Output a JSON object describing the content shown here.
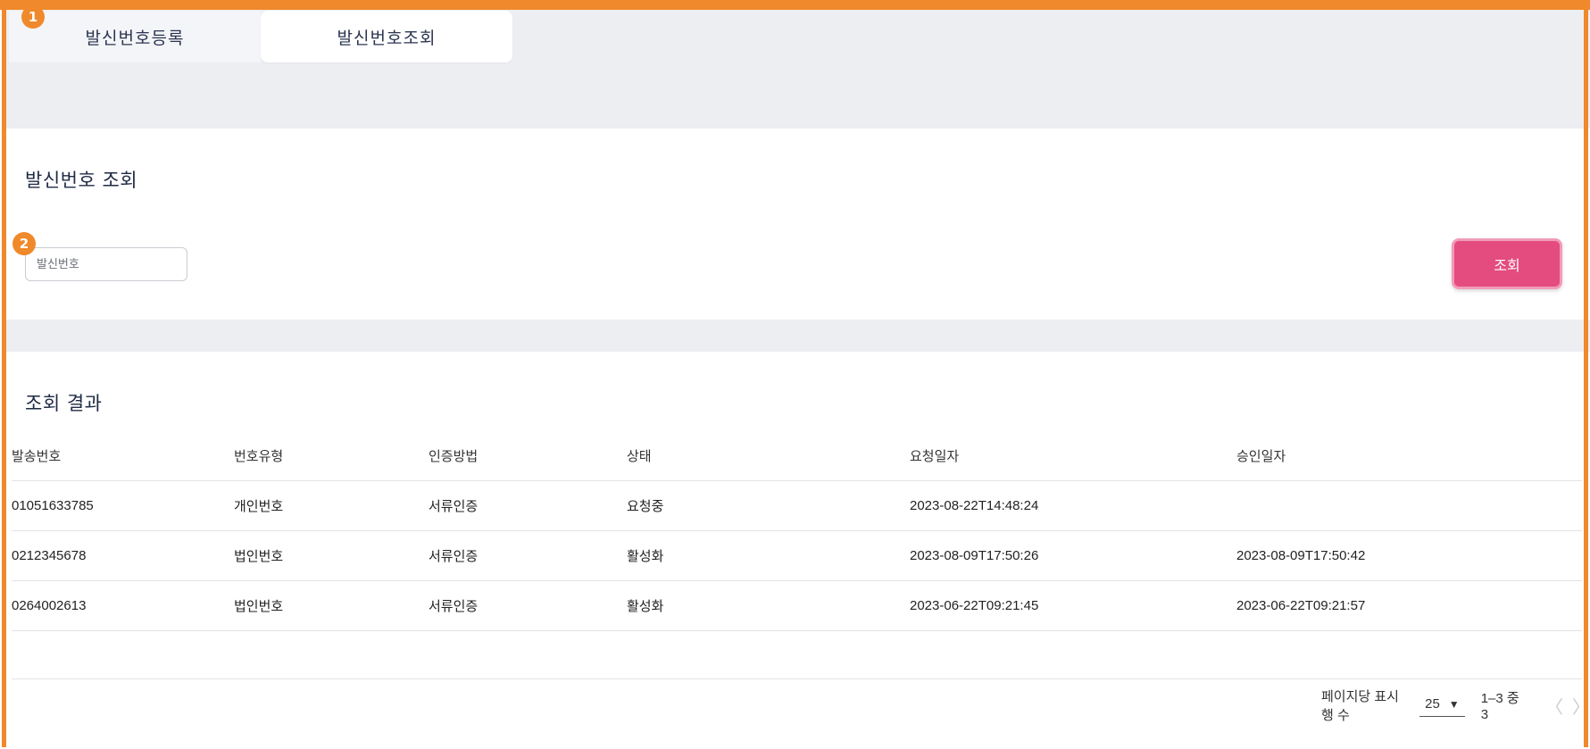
{
  "markers": [
    "1",
    "2"
  ],
  "tabs": [
    {
      "label": "발신번호등록"
    },
    {
      "label": "발신번호조회"
    }
  ],
  "search": {
    "title": "발신번호 조회",
    "placeholder": "발신번호",
    "button_label": "조회"
  },
  "results": {
    "title": "조회 결과",
    "columns": [
      "발송번호",
      "번호유형",
      "인증방법",
      "상태",
      "요청일자",
      "승인일자"
    ],
    "rows": [
      [
        "01051633785",
        "개인번호",
        "서류인증",
        "요청중",
        "2023-08-22T14:48:24",
        ""
      ],
      [
        "0212345678",
        "법인번호",
        "서류인증",
        "활성화",
        "2023-08-09T17:50:26",
        "2023-08-09T17:50:42"
      ],
      [
        "0264002613",
        "법인번호",
        "서류인증",
        "활성화",
        "2023-06-22T09:21:45",
        "2023-06-22T09:21:57"
      ]
    ]
  },
  "pagination": {
    "rows_per_page_label": "페이지당 표시 행 수",
    "rows_per_page_value": "25",
    "caret_icon": "▼",
    "range_label": "1–3 중 3",
    "prev_icon": "〈",
    "next_icon": "〉"
  },
  "colors": {
    "accent": "#f0892b",
    "primary_button": "#e44c7f",
    "background_gray": "#edeef2"
  }
}
